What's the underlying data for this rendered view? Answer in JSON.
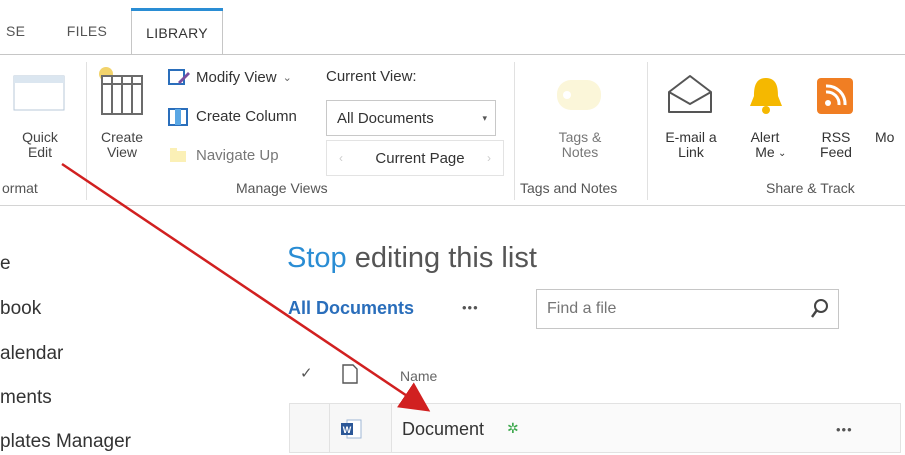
{
  "tabs": [
    {
      "label": "SE"
    },
    {
      "label": "FILES"
    },
    {
      "label": "LIBRARY"
    }
  ],
  "ribbon": {
    "format_group": {
      "quick_edit": "Quick\nEdit",
      "label": "ormat"
    },
    "manage_views": {
      "create_view": "Create\nView",
      "modify_view": "Modify View",
      "create_column": "Create Column",
      "navigate_up": "Navigate Up",
      "current_view_label": "Current View:",
      "current_view_value": "All Documents",
      "current_page": "Current Page",
      "label": "Manage Views"
    },
    "tags_notes": {
      "button": "Tags &\nNotes",
      "label": "Tags and Notes"
    },
    "share_track": {
      "email_link": "E-mail a\nLink",
      "alert_me": "Alert\nMe",
      "rss_feed": "RSS\nFeed",
      "more": "Mo",
      "label": "Share & Track"
    }
  },
  "left_nav": [
    "e",
    "book",
    "alendar",
    "ments",
    "plates Manager"
  ],
  "main": {
    "heading_accent": "Stop",
    "heading_rest": " editing this list",
    "view_label": "All Documents",
    "view_more": "•••",
    "search_placeholder": "Find a file",
    "columns": {
      "name": "Name"
    },
    "rows": [
      {
        "name": "Document",
        "more": "•••"
      }
    ]
  },
  "colors": {
    "accent": "#2a8dd4",
    "arrow": "#d12020",
    "rss": "#f07e23",
    "bell": "#f5b800"
  }
}
